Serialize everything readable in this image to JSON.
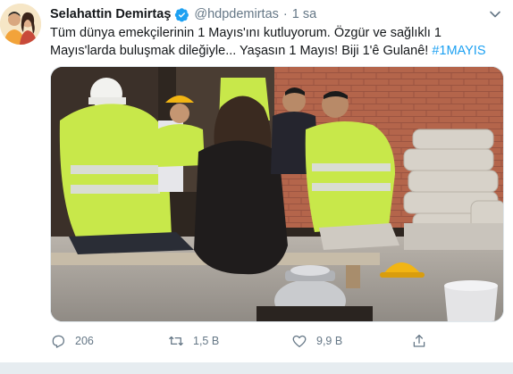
{
  "tweet": {
    "author_name": "Selahattin Demirtaş",
    "handle": "@hdpdemirtas",
    "separator": "·",
    "time": "1 sa",
    "text_line1": "Tüm dünya emekçilerinin 1 Mayıs'ını kutluyorum. Özgür ve sağlıklı 1",
    "text_line2": "Mayıs'larda buluşmak dileğiyle... Yaşasın 1 Mayıs! Biji 1'ê Gulanê! ",
    "hashtag": "#1MAYIS"
  },
  "actions": {
    "reply_count": "206",
    "retweet_count": "1,5 B",
    "like_count": "9,9 B"
  },
  "icons": {
    "verified": "verified-badge-icon",
    "caret": "chevron-down-icon",
    "reply": "reply-icon",
    "retweet": "retweet-icon",
    "like": "heart-icon",
    "share": "share-icon"
  },
  "colors": {
    "accent": "#1da1f2",
    "secondary_text": "#657786",
    "primary_text": "#14171a"
  }
}
